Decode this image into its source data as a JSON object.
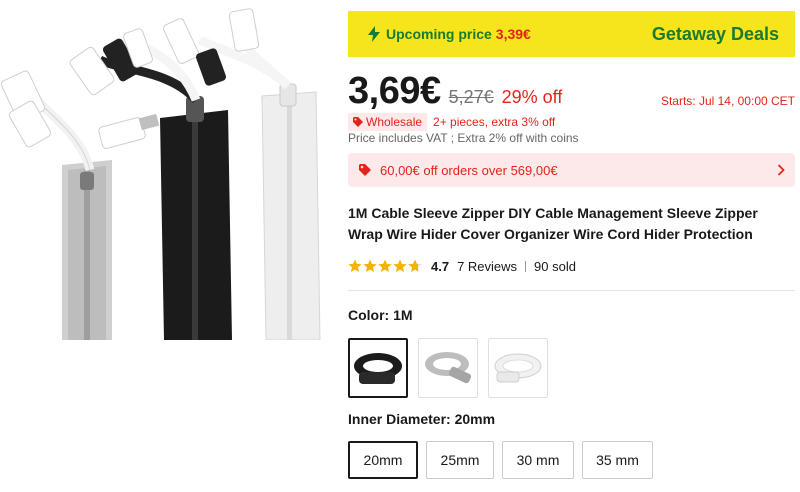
{
  "promo": {
    "upcoming_label": "Upcoming price",
    "upcoming_price": "3,39€",
    "deal_name": "Getaway Deals"
  },
  "price": {
    "current": "3,69€",
    "original": "5,27€",
    "discount": "29% off",
    "starts": "Starts:  Jul 14, 00:00 CET"
  },
  "wholesale": {
    "badge": "Wholesale",
    "text": "2+ pieces, extra 3% off"
  },
  "vat_note": "Price includes VAT ; Extra 2% off with coins",
  "coupon": {
    "text": "60,00€ off orders over 569,00€"
  },
  "product": {
    "title": "1M Cable Sleeve Zipper DIY Cable Management Sleeve Zipper Wrap Wire Hider Cover Organizer Wire Cord Hider Protection"
  },
  "rating": {
    "stars": 4.7,
    "value": "4.7",
    "reviews": "7 Reviews",
    "sold": "90 sold"
  },
  "color": {
    "label": "Color: 1M",
    "options": [
      "black",
      "gray",
      "white"
    ],
    "selected": "black"
  },
  "diameter": {
    "label": "Inner Diameter: 20mm",
    "options": [
      "20mm",
      "25mm",
      "30 mm",
      "35 mm"
    ],
    "selected": "20mm"
  },
  "colors": {
    "accent_red": "#e1251b",
    "promo_yellow": "#f6e51a",
    "promo_green": "#1a7a2e",
    "star_yellow": "#f5b301"
  }
}
